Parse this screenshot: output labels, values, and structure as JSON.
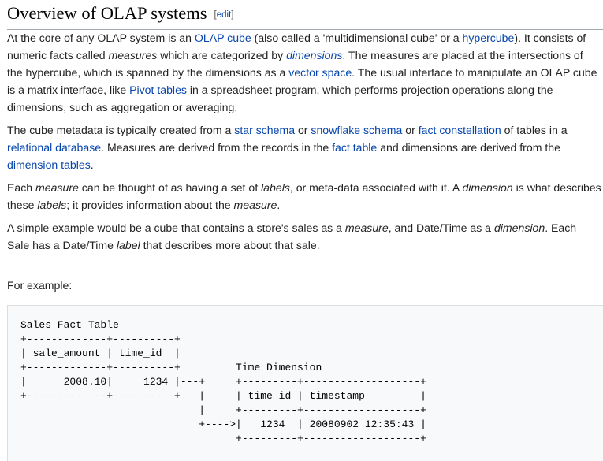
{
  "section": {
    "title": "Overview of OLAP systems",
    "edit_open": "[",
    "edit_label": "edit",
    "edit_close": "]"
  },
  "paragraphs": {
    "p1": {
      "t1": "At the core of any OLAP system is an ",
      "l1": "OLAP cube",
      "t2": " (also called a 'multidimensional cube' or a ",
      "l2": "hypercube",
      "t3": "). It consists of numeric facts called ",
      "e1": "measures",
      "t4": " which are categorized by ",
      "l3": "dimensions",
      "t5": ". The measures are placed at the intersections of the hypercube, which is spanned by the dimensions as a ",
      "l4": "vector space",
      "t6": ". The usual interface to manipulate an OLAP cube is a matrix interface, like ",
      "l5": "Pivot tables",
      "t7": " in a spreadsheet program, which performs projection operations along the dimensions, such as aggregation or averaging."
    },
    "p2": {
      "t1": "The cube metadata is typically created from a ",
      "l1": "star schema",
      "t2": " or ",
      "l2": "snowflake schema",
      "t3": " or ",
      "l3": "fact constellation",
      "t4": " of tables in a ",
      "l4": "relational database",
      "t5": ". Measures are derived from the records in the ",
      "l5": "fact table",
      "t6": " and dimensions are derived from the ",
      "l6": "dimension tables",
      "t7": "."
    },
    "p3": {
      "t1": "Each ",
      "e1": "measure",
      "t2": " can be thought of as having a set of ",
      "e2": "labels",
      "t3": ", or meta-data associated with it. A ",
      "e3": "dimension",
      "t4": " is what describes these ",
      "e4": "labels",
      "t5": "; it provides information about the ",
      "e5": "measure",
      "t6": "."
    },
    "p4": {
      "t1": "A simple example would be a cube that contains a store's sales as a ",
      "e1": "measure",
      "t2": ", and Date/Time as a ",
      "e2": "dimension",
      "t3": ". Each Sale has a Date/Time ",
      "e3": "label",
      "t4": " that describes more about that sale."
    },
    "p5": {
      "t1": "For example:"
    }
  },
  "example_block": {
    "text": "Sales Fact Table\n+-------------+----------+\n| sale_amount | time_id  |\n+-------------+----------+         Time Dimension\n|      2008.10|     1234 |---+     +---------+-------------------+\n+-------------+----------+   |     | time_id | timestamp         |\n                             |     +---------+-------------------+\n                             +---->|   1234  | 20080902 12:35:43 |\n                                   +---------+-------------------+"
  }
}
